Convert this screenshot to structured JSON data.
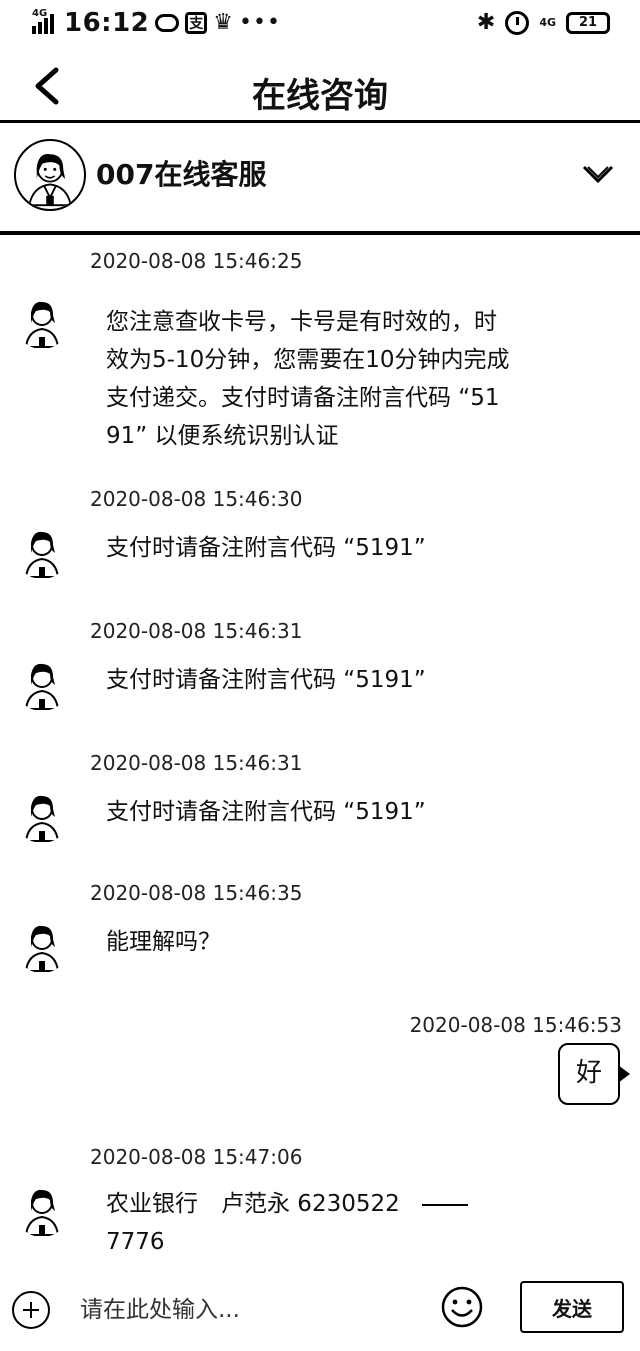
{
  "status_bar": {
    "time": "16:12",
    "net_left": "4G",
    "badge_icon_text": "支",
    "dots": "•••",
    "net_right": "4G",
    "battery": "21"
  },
  "nav": {
    "title": "在线咨询"
  },
  "agent": {
    "name": "007在线客服"
  },
  "messages": [
    {
      "side": "left",
      "timestamp": "2020-08-08 15:46:25",
      "lines": [
        "您注意查收卡号，卡号是有时效的，时",
        "效为5-10分钟，您需要在10分钟内完成",
        "支付递交。支付时请备注附言代码 “51",
        "91” 以便系统识别认证"
      ]
    },
    {
      "side": "left",
      "timestamp": "2020-08-08 15:46:30",
      "lines": [
        "支付时请备注附言代码 “5191”"
      ]
    },
    {
      "side": "left",
      "timestamp": "2020-08-08 15:46:31",
      "lines": [
        "支付时请备注附言代码 “5191”"
      ]
    },
    {
      "side": "left",
      "timestamp": "2020-08-08 15:46:31",
      "lines": [
        "支付时请备注附言代码 “5191”"
      ]
    },
    {
      "side": "left",
      "timestamp": "2020-08-08 15:46:35",
      "lines": [
        "能理解吗？"
      ]
    },
    {
      "side": "right",
      "timestamp": "2020-08-08 15:46:53",
      "lines": [
        "好"
      ]
    },
    {
      "side": "left",
      "timestamp": "2020-08-08 15:47:06",
      "lines": [
        "农业银行　卢范永  6230522",
        "7776"
      ]
    }
  ],
  "input": {
    "placeholder": "请在此处输入..."
  },
  "send_label": "发送",
  "icons": {
    "back": "chevron-left-icon",
    "collapse": "chevron-down-icon",
    "add": "plus-icon",
    "emoji": "smiley-icon"
  }
}
